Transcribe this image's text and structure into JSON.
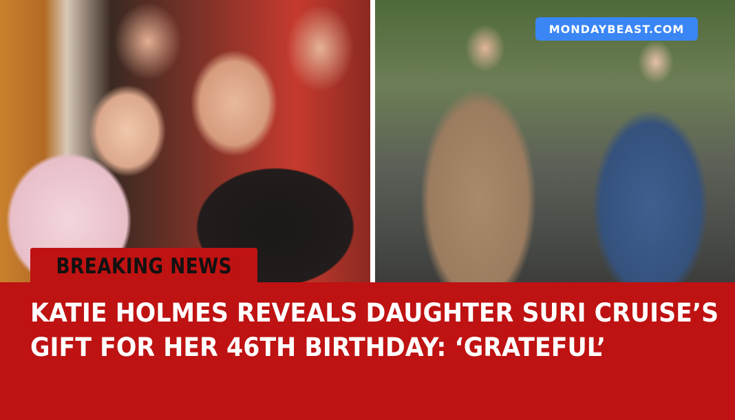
{
  "brand": {
    "label": "MONDAYBEAST.COM"
  },
  "tag": {
    "label": "BREAKING NEWS"
  },
  "headline": {
    "line1": "KATIE HOLMES REVEALS DAUGHTER SURI CRUISE’S",
    "line2": "GIFT FOR HER 46TH BIRTHDAY: ‘GRATEFUL’"
  },
  "colors": {
    "banner": "#bf1212",
    "badge": "#3a86f5",
    "headline_text": "#ffffff",
    "tag_text": "#111111"
  },
  "images": {
    "left": "photo-katie-holmes-and-suri-cruise-courtside",
    "right": "photo-katie-holmes-and-suri-cruise-walking"
  }
}
